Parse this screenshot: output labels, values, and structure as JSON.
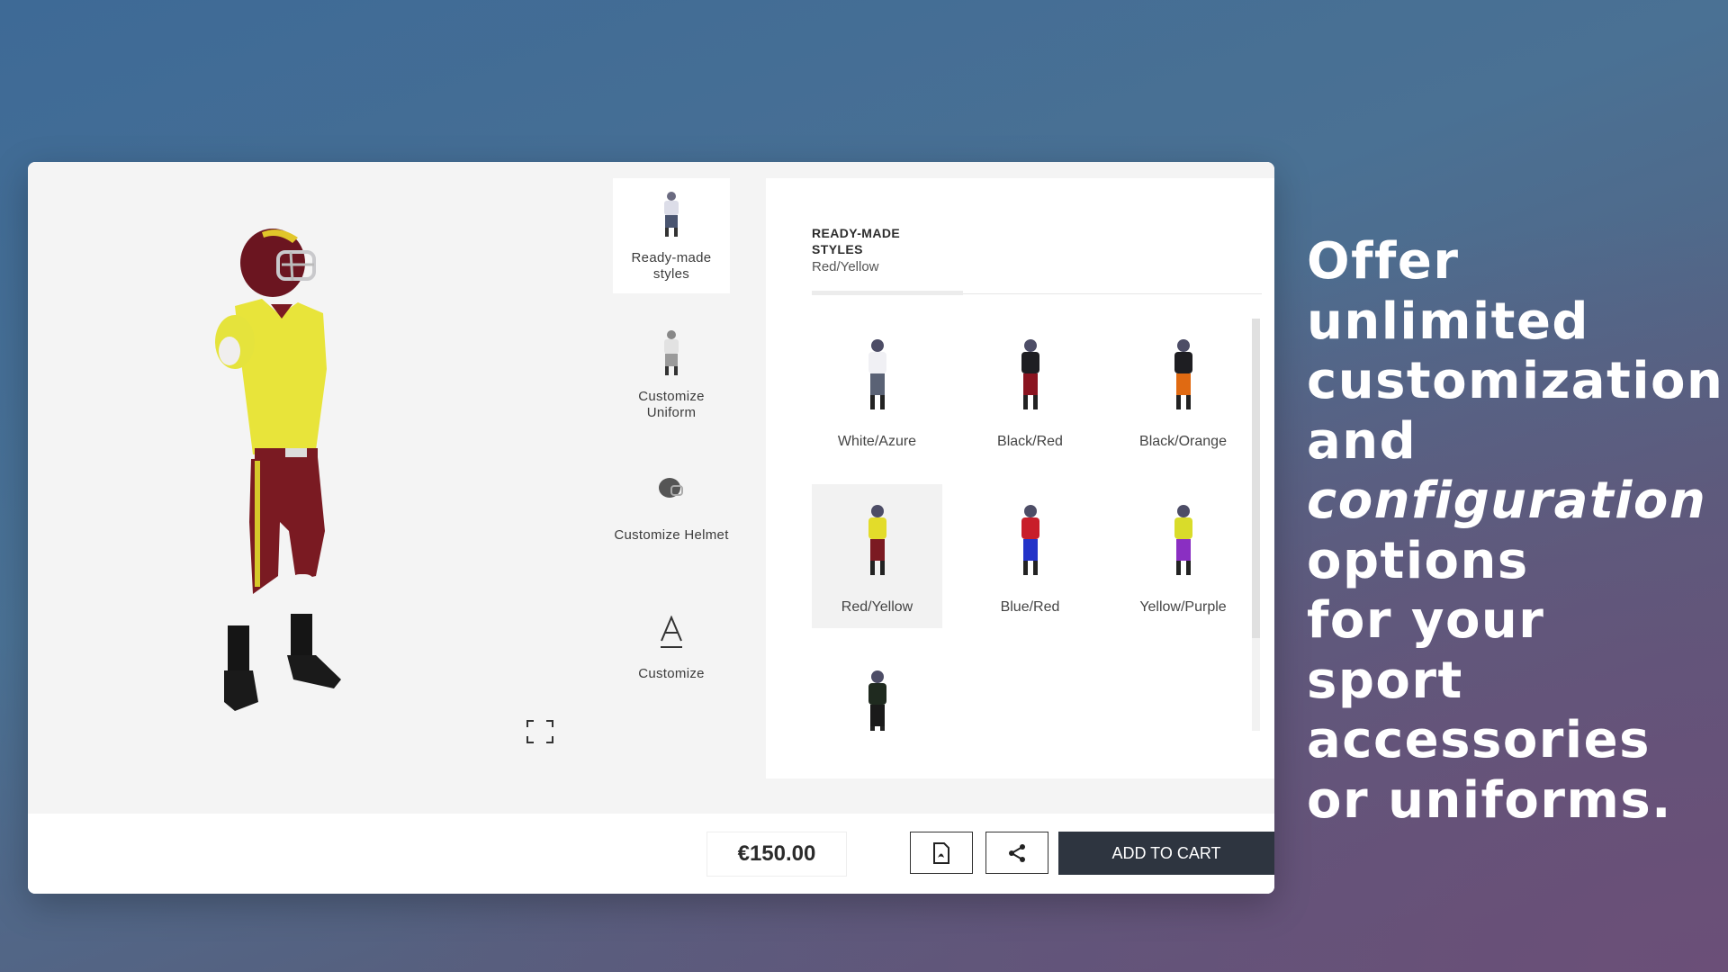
{
  "nav": {
    "items": [
      {
        "label": "Ready-made styles",
        "icon": "uniform-thumbnail-icon"
      },
      {
        "label": "Customize Uniform",
        "icon": "uniform-silhouette-icon"
      },
      {
        "label": "Customize Helmet",
        "icon": "helmet-icon"
      },
      {
        "label": "Customize",
        "icon": "text-a-icon"
      }
    ]
  },
  "panel": {
    "title": "READY-MADE STYLES",
    "selected": "Red/Yellow",
    "styles": [
      {
        "label": "White/Azure",
        "jersey": "#f0f0f4",
        "pants": "#5a6275"
      },
      {
        "label": "Black/Red",
        "jersey": "#1e1e22",
        "pants": "#8a1420"
      },
      {
        "label": "Black/Orange",
        "jersey": "#1e1e22",
        "pants": "#e06a12"
      },
      {
        "label": "Red/Yellow",
        "jersey": "#e3dc2a",
        "pants": "#7b1a22"
      },
      {
        "label": "Blue/Red",
        "jersey": "#c81e2a",
        "pants": "#2333c8"
      },
      {
        "label": "Yellow/Purple",
        "jersey": "#d9dc2a",
        "pants": "#8a2fc2"
      },
      {
        "label": "",
        "jersey": "#1f2a1f",
        "pants": "#1a1a1a"
      }
    ]
  },
  "bottom": {
    "price": "€150.00",
    "pdf_icon": "pdf-icon",
    "share_icon": "share-icon",
    "cart_label": "ADD TO CART"
  },
  "headline": {
    "lines": [
      "Offer",
      "unlimited",
      "customization",
      "and",
      "configuration",
      "options",
      "for your",
      "sport",
      "accessories",
      "or uniforms."
    ]
  },
  "colors": {
    "jersey": "#e8e43a",
    "pants": "#7a1a22",
    "helmet": "#6b1520",
    "cart_button": "#2e3540"
  }
}
